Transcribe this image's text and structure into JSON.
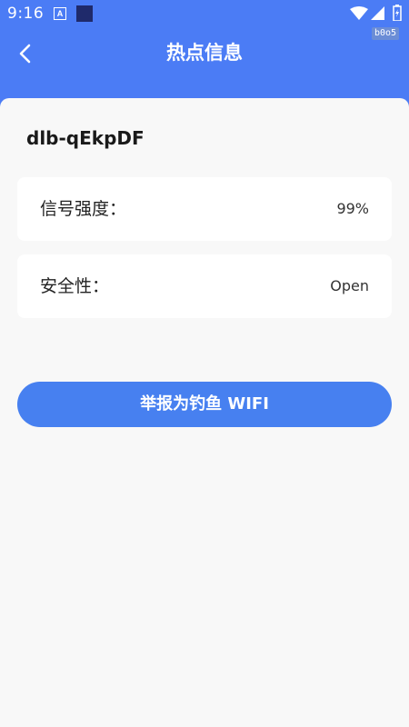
{
  "status_bar": {
    "time": "9:16",
    "a_icon_letter": "A",
    "icons": [
      "wifi-icon",
      "cellular-signal-icon",
      "battery-icon"
    ],
    "debug_badge": "b0o5"
  },
  "header": {
    "title": "热点信息",
    "back_icon": "chevron-left-icon"
  },
  "hotspot": {
    "ssid": "dlb-qEkpDF",
    "rows": [
      {
        "label": "信号强度：",
        "value": "99%"
      },
      {
        "label": "安全性：",
        "value": "Open"
      }
    ]
  },
  "actions": {
    "report_label": "举报为钓鱼 WIFI"
  },
  "colors": {
    "header_blue": "#4b7cf5",
    "button_blue": "#4780f0",
    "page_bg": "#f8f8f8",
    "card_bg": "#ffffff"
  }
}
